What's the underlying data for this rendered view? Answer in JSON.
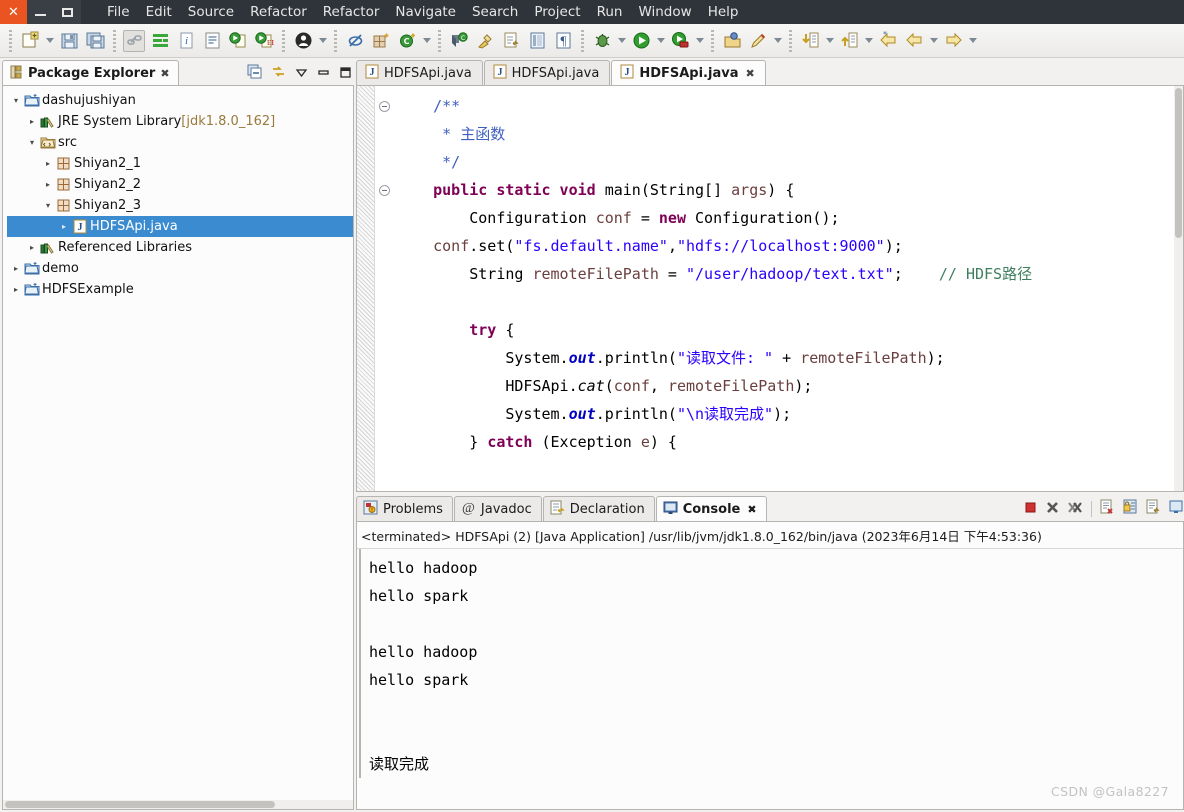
{
  "window": {
    "close_label": "✕",
    "minimize_label": "—",
    "maximize_label": "▭"
  },
  "menu": {
    "items": [
      "File",
      "Edit",
      "Source",
      "Refactor",
      "Refactor",
      "Navigate",
      "Search",
      "Project",
      "Run",
      "Window",
      "Help"
    ]
  },
  "toolbar": {
    "icons": [
      "new-file-icon",
      "new-dropdown-arrow",
      "save-icon",
      "save-all-icon",
      "separator-1",
      "link-editor-icon",
      "toggle-breakpoints-icon",
      "quick-access-icon",
      "open-task-icon",
      "run-last-tool-icon",
      "external-tools-icon",
      "separator-2",
      "person-icon",
      "person-dropdown-arrow",
      "separator-3",
      "skip-breakpoints-icon",
      "new-java-project-icon",
      "new-class-icon",
      "new-class-dropdown-arrow",
      "separator-4",
      "open-type-icon",
      "search-icon",
      "next-annotation-icon",
      "previous-annotation-icon",
      "pilcrow-icon",
      "separator-5",
      "debug-icon",
      "debug-dropdown-arrow",
      "run-icon",
      "run-dropdown-arrow",
      "coverage-icon",
      "coverage-dropdown-arrow",
      "separator-6",
      "open-perspective-icon",
      "pencil-icon",
      "pencil-dropdown-arrow",
      "separator-7",
      "step-into-icon",
      "step-into-dropdown-arrow",
      "step-return-icon",
      "step-return-dropdown-arrow",
      "back-star-icon",
      "back-arrow-icon",
      "back-dropdown-arrow",
      "forward-arrow-icon",
      "forward-dropdown-arrow"
    ]
  },
  "package_explorer": {
    "title": "Package Explorer",
    "close_glyph": "✖",
    "view_tools": [
      "collapse-all-icon",
      "link-with-editor-icon",
      "view-menu-icon",
      "minimize-icon",
      "maximize-icon"
    ],
    "tree": [
      {
        "depth": 0,
        "twisty": "▾",
        "icon": "project-icon",
        "label": "dashujushiyan",
        "sub": "",
        "selected": false
      },
      {
        "depth": 1,
        "twisty": "▸",
        "icon": "library-icon",
        "label": "JRE System Library ",
        "sub": "[jdk1.8.0_162]",
        "selected": false
      },
      {
        "depth": 1,
        "twisty": "▾",
        "icon": "source-folder-icon",
        "label": "src",
        "sub": "",
        "selected": false
      },
      {
        "depth": 2,
        "twisty": "▸",
        "icon": "package-icon",
        "label": "Shiyan2_1",
        "sub": "",
        "selected": false
      },
      {
        "depth": 2,
        "twisty": "▸",
        "icon": "package-icon",
        "label": "Shiyan2_2",
        "sub": "",
        "selected": false
      },
      {
        "depth": 2,
        "twisty": "▾",
        "icon": "package-icon",
        "label": "Shiyan2_3",
        "sub": "",
        "selected": false
      },
      {
        "depth": 3,
        "twisty": "▸",
        "icon": "java-file-icon",
        "label": "HDFSApi.java",
        "sub": "",
        "selected": true
      },
      {
        "depth": 1,
        "twisty": "▸",
        "icon": "library-icon",
        "label": "Referenced Libraries",
        "sub": "",
        "selected": false
      },
      {
        "depth": 0,
        "twisty": "▸",
        "icon": "project-icon",
        "label": "demo",
        "sub": "",
        "selected": false
      },
      {
        "depth": 0,
        "twisty": "▸",
        "icon": "project-icon",
        "label": "HDFSExample",
        "sub": "",
        "selected": false
      }
    ]
  },
  "editor": {
    "tabs": [
      {
        "label": "HDFSApi.java",
        "active": false,
        "close_glyph": ""
      },
      {
        "label": "HDFSApi.java",
        "active": false,
        "close_glyph": ""
      },
      {
        "label": "HDFSApi.java",
        "active": true,
        "close_glyph": "✖"
      }
    ],
    "code_lines": [
      {
        "fold": true,
        "indent": 4,
        "tokens": [
          {
            "t": "/**",
            "c": "jdoc"
          }
        ]
      },
      {
        "fold": false,
        "indent": 5,
        "tokens": [
          {
            "t": "* 主函数",
            "c": "jdoc"
          }
        ]
      },
      {
        "fold": false,
        "indent": 5,
        "tokens": [
          {
            "t": "*/",
            "c": "jdoc"
          }
        ]
      },
      {
        "fold": true,
        "indent": 4,
        "tokens": [
          {
            "t": "public static void ",
            "c": "kw"
          },
          {
            "t": "main(String[] ",
            "c": ""
          },
          {
            "t": "args",
            "c": "var"
          },
          {
            "t": ") {",
            "c": ""
          }
        ]
      },
      {
        "fold": false,
        "indent": 8,
        "tokens": [
          {
            "t": "Configuration ",
            "c": ""
          },
          {
            "t": "conf",
            "c": "var"
          },
          {
            "t": " = ",
            "c": ""
          },
          {
            "t": "new ",
            "c": "kw"
          },
          {
            "t": "Configuration();",
            "c": ""
          }
        ]
      },
      {
        "fold": false,
        "indent": 4,
        "tokens": [
          {
            "t": "conf",
            "c": "var"
          },
          {
            "t": ".set(",
            "c": ""
          },
          {
            "t": "\"fs.default.name\"",
            "c": "str"
          },
          {
            "t": ",",
            "c": ""
          },
          {
            "t": "\"hdfs://localhost:9000\"",
            "c": "str"
          },
          {
            "t": ");",
            "c": ""
          }
        ]
      },
      {
        "fold": false,
        "indent": 8,
        "tokens": [
          {
            "t": "String ",
            "c": ""
          },
          {
            "t": "remoteFilePath",
            "c": "var"
          },
          {
            "t": " = ",
            "c": ""
          },
          {
            "t": "\"/user/hadoop/text.txt\"",
            "c": "str"
          },
          {
            "t": ";    ",
            "c": ""
          },
          {
            "t": "// HDFS路径",
            "c": "cmt"
          }
        ]
      },
      {
        "fold": false,
        "indent": 0,
        "tokens": []
      },
      {
        "fold": false,
        "indent": 8,
        "tokens": [
          {
            "t": "try ",
            "c": "kw"
          },
          {
            "t": "{",
            "c": ""
          }
        ]
      },
      {
        "fold": false,
        "indent": 12,
        "tokens": [
          {
            "t": "System.",
            "c": ""
          },
          {
            "t": "out",
            "c": "fld"
          },
          {
            "t": ".println(",
            "c": ""
          },
          {
            "t": "\"读取文件: \"",
            "c": "str"
          },
          {
            "t": " + ",
            "c": ""
          },
          {
            "t": "remoteFilePath",
            "c": "var"
          },
          {
            "t": ");",
            "c": ""
          }
        ]
      },
      {
        "fold": false,
        "indent": 12,
        "tokens": [
          {
            "t": "HDFSApi.",
            "c": ""
          },
          {
            "t": "cat",
            "c": "mth"
          },
          {
            "t": "(",
            "c": ""
          },
          {
            "t": "conf",
            "c": "var"
          },
          {
            "t": ", ",
            "c": ""
          },
          {
            "t": "remoteFilePath",
            "c": "var"
          },
          {
            "t": ");",
            "c": ""
          }
        ]
      },
      {
        "fold": false,
        "indent": 12,
        "tokens": [
          {
            "t": "System.",
            "c": ""
          },
          {
            "t": "out",
            "c": "fld"
          },
          {
            "t": ".println(",
            "c": ""
          },
          {
            "t": "\"\\n读取完成\"",
            "c": "str"
          },
          {
            "t": ");",
            "c": ""
          }
        ]
      },
      {
        "fold": false,
        "indent": 8,
        "tokens": [
          {
            "t": "} ",
            "c": ""
          },
          {
            "t": "catch ",
            "c": "kw"
          },
          {
            "t": "(Exception ",
            "c": ""
          },
          {
            "t": "e",
            "c": "var"
          },
          {
            "t": ") {",
            "c": ""
          }
        ]
      }
    ]
  },
  "console_panel": {
    "tabs": [
      {
        "label": "Problems",
        "icon": "problems-icon",
        "active": false,
        "close_glyph": ""
      },
      {
        "label": "Javadoc",
        "icon": "javadoc-icon",
        "active": false,
        "close_glyph": ""
      },
      {
        "label": "Declaration",
        "icon": "declaration-icon",
        "active": false,
        "close_glyph": ""
      },
      {
        "label": "Console",
        "icon": "console-icon",
        "active": true,
        "close_glyph": "✖"
      }
    ],
    "tools": [
      "terminate-icon",
      "remove-launch-icon",
      "remove-all-terminated-icon",
      "clear-console-icon",
      "scroll-lock-icon",
      "pin-console-icon",
      "display-console-icon"
    ],
    "launch_header": "<terminated> HDFSApi (2) [Java Application] /usr/lib/jvm/jdk1.8.0_162/bin/java (2023年6月14日 下午4:53:36)",
    "output": "hello hadoop\nhello spark\n\nhello hadoop\nhello spark\n\n\n读取完成"
  },
  "watermark": "CSDN @Gala8227"
}
